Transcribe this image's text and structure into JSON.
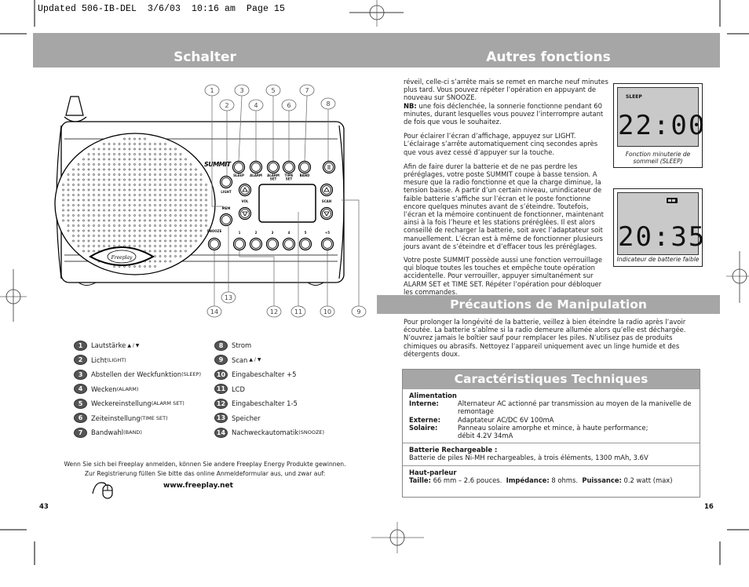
{
  "slug": "Updated 506-IB-DEL  3/6/03  10:16 am  Page 15",
  "left_page": {
    "title": "Schalter",
    "page_number": "43",
    "radio": {
      "brand": "SUMMIT",
      "logo": "Freeplay",
      "buttons_top": [
        "SLEEP",
        "ALARM",
        "ALARM SET",
        "TIME SET",
        "BAND"
      ],
      "light_label": "LIGHT",
      "vol_label": "VOL",
      "mem_label": "MEM",
      "scan_label": "SCAN",
      "snooze_label": "SNOOZE",
      "preset_labels": [
        "1",
        "2",
        "3",
        "4",
        "5",
        "+5"
      ],
      "callouts": [
        "1",
        "2",
        "3",
        "4",
        "5",
        "6",
        "7",
        "8",
        "9",
        "10",
        "11",
        "12",
        "13",
        "14"
      ]
    },
    "legend_left": [
      {
        "num": "1",
        "text": "Lautstärke",
        "suffix": "▲ / ▼"
      },
      {
        "num": "2",
        "text": "Licht ",
        "suffix_sc": "(Light)"
      },
      {
        "num": "3",
        "text": "Abstellen der Weckfunktion ",
        "suffix_sc": "(Sleep)"
      },
      {
        "num": "4",
        "text": "Wecken ",
        "suffix_sc": "(Alarm)"
      },
      {
        "num": "5",
        "text": "Weckereinstellung ",
        "suffix_sc": "(Alarm Set)"
      },
      {
        "num": "6",
        "text": "Zeiteinstellung ",
        "suffix_sc": "(Time Set)"
      },
      {
        "num": "7",
        "text": "Bandwahl ",
        "suffix_sc": "(Band)"
      }
    ],
    "legend_right": [
      {
        "num": "8",
        "text": "Strom"
      },
      {
        "num": "9",
        "text": "Scan",
        "suffix": "▲ / ▼"
      },
      {
        "num": "10",
        "text": "Eingabeschalter +5"
      },
      {
        "num": "11",
        "text": "LCD"
      },
      {
        "num": "12",
        "text": "Eingabeschalter 1-5"
      },
      {
        "num": "13",
        "text": "Speicher"
      },
      {
        "num": "14",
        "text": "Nachweckautomatik ",
        "suffix_sc": "(Snooze)"
      }
    ],
    "registration": {
      "line1": "Wenn Sie sich bei Freeplay anmelden, können Sie andere Freeplay Energy Produkte gewinnen.",
      "line2": "Zur Registrierung füllen Sie bitte das online Anmeldeformular aus, und zwar auf:",
      "url": "www.freeplay.net",
      "icon": "mouse-icon"
    }
  },
  "right_page": {
    "title": "Autres fonctions",
    "page_number": "16",
    "paragraphs": {
      "p1": "réveil, celle-ci s’arrête mais se remet en marche neuf minutes plus tard. Vous pouvez répéter l’opération en appuyant de nouveau sur SNOOZE.",
      "nb_label": "NB:",
      "nb_text": " une fois déclenchée, la sonnerie fonctionne pendant 60 minutes, durant lesquelles vous pouvez l’interrompre autant de fois que vous le souhaitez.",
      "p2": "Pour éclairer l’écran d’affichage, appuyez sur LIGHT. L’éclairage s’arrête automatiquement cinq secondes après que vous avez cessé d’appuyer sur la touche.",
      "p3": "Afin de faire durer la batterie et de ne pas perdre les préréglages, votre poste SUMMIT coupe à basse tension. A mesure que la radio fonctionne et que la charge diminue, la tension baisse. A partir d’un certain niveau, unindicateur de faible batterie s’affiche sur l’écran et le poste fonctionne encore quelques minutes avant de s’éteindre. Toutefois, l’écran et la mémoire continuent de fonctionner, maintenant ainsi à la fois l’heure et les stations préréglées. Il est alors conseillé de recharger la batterie, soit avec l’adaptateur soit manuellement. L’écran est à même de fonctionner plusieurs jours avant de s’éteindre et d’effacer tous les préréglages.",
      "p4": "Votre poste SUMMIT possède aussi une fonction verrouillage qui bloque toutes les touches et empêche toute opération accidentelle. Pour verrouiller, appuyer simultanément sur ALARM SET et TIME SET. Répéter l’opération pour débloquer les commandes."
    },
    "lcd1": {
      "indicator": "SLEEP",
      "time": "22:00",
      "caption": "Fonction minuterie de sommeil (SLEEP)"
    },
    "lcd2": {
      "indicator": "battery-icon",
      "time": "20:35",
      "caption": "Indicateur de batterie faible"
    },
    "precautions": {
      "title": "Précautions de Manipulation",
      "text": "Pour prolonger la longévité de la batterie, veillez à bien éteindre la radio après l’avoir écoutée. La batterie s’abîme si la radio demeure allumée alors qu’elle est déchargée. N’ouvrez jamais le boîtier sauf pour remplacer les piles. N’utilisez pas de produits chimiques ou abrasifs. Nettoyez l’appareil uniquement avec un linge humide et des détergents doux."
    },
    "specs": {
      "title": "Caractéristiques Techniques",
      "power_title": "Alimentation",
      "power_rows": [
        {
          "key": "Interne:",
          "value": "Alternateur AC actionné par transmission au moyen de la manivelle de remontage"
        },
        {
          "key": "Externe:",
          "value": "Adaptateur AC/DC 6V 100mA"
        },
        {
          "key": "Solaire:",
          "value": "Panneau solaire amorphe et mince, à haute performance; débit 4.2V 34mA"
        }
      ],
      "battery_title": "Batterie Rechargeable :",
      "battery_text": "Batterie de piles Ni-MH rechargeables, à trois éléments, 1300 mAh, 3.6V",
      "speaker_title": "Haut-parleur",
      "speaker": {
        "size_label": "Taille:",
        "size_value": " 66 mm – 2.6 pouces.  ",
        "imp_label": "Impédance:",
        "imp_value": " 8 ohms.  ",
        "power_label": "Puissance:",
        "power_value": " 0.2 watt (max)"
      }
    }
  },
  "colors": {
    "band_gray": "#a6a6a6",
    "lcd_gray": "#c9c9c9",
    "badge_gray": "#555555"
  }
}
